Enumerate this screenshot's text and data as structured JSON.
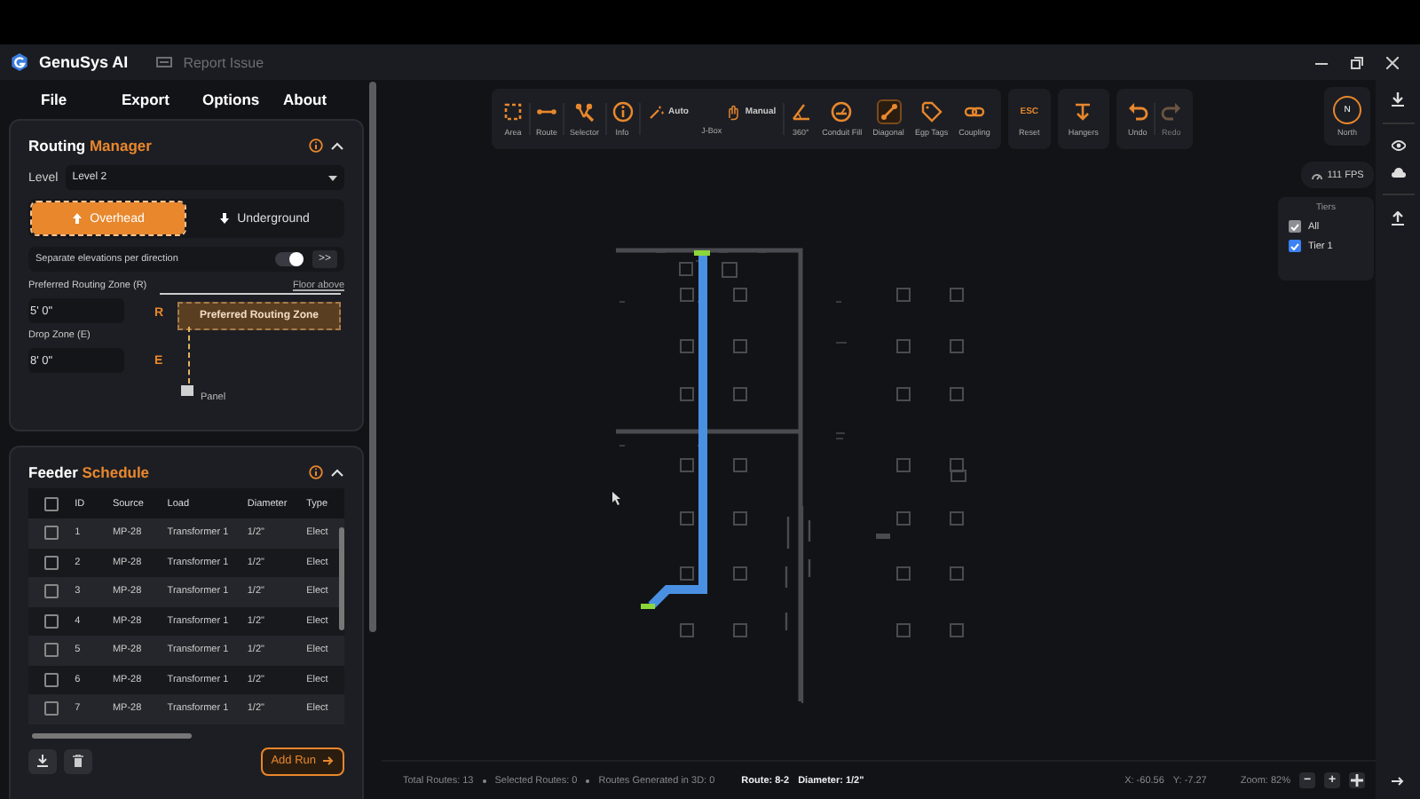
{
  "window": {
    "title": "GenuSys AI",
    "report": "Report Issue"
  },
  "menu": [
    "File",
    "Export",
    "Options",
    "About"
  ],
  "routing_manager": {
    "title": "Routing",
    "title_accent": "Manager",
    "expanded": true,
    "level_label": "Level",
    "level_value": "Level 2",
    "modes": [
      {
        "label": "Overhead",
        "kind": "up",
        "selected": true
      },
      {
        "label": "Underground",
        "kind": "down",
        "selected": false
      }
    ],
    "separate": {
      "label": "Separate elevations per direction",
      "on": true
    },
    "more_button": ">>",
    "preferred_label": "Preferred Routing Zone (R)",
    "preferred_value": "5' 0\"",
    "drop_label": "Drop Zone (E)",
    "drop_value": "8' 0\"",
    "diagram": {
      "floor_label": "Floor above",
      "zone_label": "Preferred Routing Zone",
      "r_mark": "R",
      "e_mark": "E",
      "panel_label": "Panel"
    }
  },
  "feeder_schedule": {
    "title": "Feeder",
    "title_accent": "Schedule",
    "expanded": true,
    "all_checked": false,
    "columns": [
      "ID",
      "Source",
      "Load",
      "Diameter",
      "Type"
    ],
    "rows": [
      {
        "cells": [
          "1",
          "MP-28",
          "Transformer 1",
          "1/2\"",
          "Elect"
        ],
        "checked": false
      },
      {
        "cells": [
          "2",
          "MP-28",
          "Transformer 1",
          "1/2\"",
          "Elect"
        ],
        "checked": false
      },
      {
        "cells": [
          "3",
          "MP-28",
          "Transformer 1",
          "1/2\"",
          "Elect"
        ],
        "checked": false
      },
      {
        "cells": [
          "4",
          "MP-28",
          "Transformer 1",
          "1/2\"",
          "Elect"
        ],
        "checked": false
      },
      {
        "cells": [
          "5",
          "MP-28",
          "Transformer 1",
          "1/2\"",
          "Elect"
        ],
        "checked": false
      },
      {
        "cells": [
          "6",
          "MP-28",
          "Transformer 1",
          "1/2\"",
          "Elect"
        ],
        "checked": false
      },
      {
        "cells": [
          "7",
          "MP-28",
          "Transformer 1",
          "1/2\"",
          "Elect"
        ],
        "checked": false
      }
    ],
    "add_button": "Add Run"
  },
  "toolbar": {
    "groups": [
      {
        "tools": [
          {
            "label": "Area",
            "kind": "area",
            "selected": false
          },
          {
            "label": "Route",
            "kind": "route",
            "selected": false
          },
          {
            "label": "Selector",
            "kind": "selector",
            "selected": false
          },
          {
            "label": "Info",
            "kind": "info",
            "selected": false
          },
          {
            "label": "J-Box",
            "kind": "pair",
            "options": [
              "Auto",
              "Manual"
            ]
          },
          {
            "label": "360°",
            "kind": "angle",
            "selected": false
          },
          {
            "label": "Conduit Fill",
            "kind": "gauge",
            "selected": false
          },
          {
            "label": "Diagonal",
            "kind": "diagonal",
            "selected": true
          },
          {
            "label": "Egp Tags",
            "kind": "tag",
            "selected": false
          },
          {
            "label": "Coupling",
            "kind": "link",
            "selected": false
          }
        ]
      },
      {
        "tools": [
          {
            "label": "Reset",
            "kind": "key",
            "key": "ESC",
            "selected": false
          }
        ]
      },
      {
        "tools": [
          {
            "label": "Hangers",
            "kind": "hanger",
            "selected": false
          }
        ]
      },
      {
        "tools": [
          {
            "label": "Undo",
            "kind": "undo",
            "selected": false,
            "disabled": false
          },
          {
            "label": "Redo",
            "kind": "redo",
            "selected": false,
            "disabled": true
          }
        ]
      }
    ]
  },
  "compass": {
    "letter": "N",
    "label": "North"
  },
  "fps": "111 FPS",
  "tiers": {
    "title": "Tiers",
    "items": [
      {
        "label": "All",
        "checked": true,
        "color": "#8e8f94"
      },
      {
        "label": "Tier 1",
        "checked": true,
        "color": "#3b82f6"
      }
    ]
  },
  "status_bar": {
    "stats": [
      "Total Routes: 13",
      "Selected Routes: 0",
      "Routes Generated in 3D: 0"
    ],
    "route": "Route: 8-2",
    "diameter": "Diameter: 1/2\"",
    "x": "X: -60.56",
    "y": "Y: -7.27",
    "zoom": "Zoom: 82%",
    "zoom_out": "−",
    "zoom_in": "+"
  }
}
